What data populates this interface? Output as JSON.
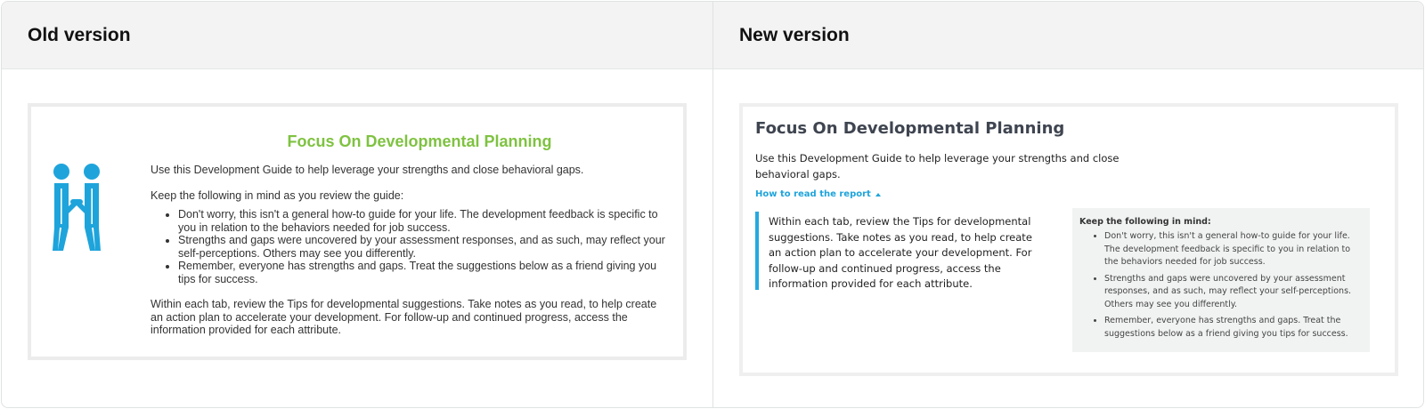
{
  "left_pane": {
    "title": "Old version",
    "card": {
      "title": "Focus On Developmental Planning",
      "intro": "Use this Development Guide to help leverage your strengths and close behavioral gaps.",
      "keep_in_mind": "Keep the following in mind as you review the guide:",
      "bullets": [
        "Don't worry, this isn't a general how-to guide for your life. The development feedback is specific to you in relation to the behaviors needed for job success.",
        "Strengths and gaps were uncovered by your assessment responses, and as such, may reflect your self-perceptions. Others may see you differently.",
        "Remember, everyone has strengths and gaps. Treat the suggestions below as a friend giving you tips for success."
      ],
      "closing": "Within each tab, review the Tips for developmental suggestions. Take notes as you read, to help create an action plan to accelerate your development. For follow-up and continued progress, access the information provided for each attribute.",
      "icon": "handshake-people-icon",
      "title_color": "#7fc241",
      "icon_color": "#1ea4db"
    }
  },
  "right_pane": {
    "title": "New version",
    "card": {
      "title": "Focus On Developmental Planning",
      "intro": "Use this Development Guide to help leverage your strengths and close behavioral gaps.",
      "toggle_label": "How to read the report",
      "quote": "Within each tab, review the Tips for developmental suggestions. Take notes as you read, to help create an action plan to accelerate your development. For follow-up and continued progress, access the information provided for each attribute.",
      "tips_heading": "Keep the following in mind:",
      "bullets": [
        "Don't worry, this isn't a general how-to guide for your life. The development feedback is specific to you in relation to the behaviors needed for job success.",
        "Strengths and gaps were uncovered by your assessment responses, and as such, may reflect your self-perceptions. Others may see you differently.",
        "Remember, everyone has strengths and gaps. Treat the suggestions below as a friend giving you tips for success."
      ],
      "accent_color": "#1ea4db"
    }
  }
}
